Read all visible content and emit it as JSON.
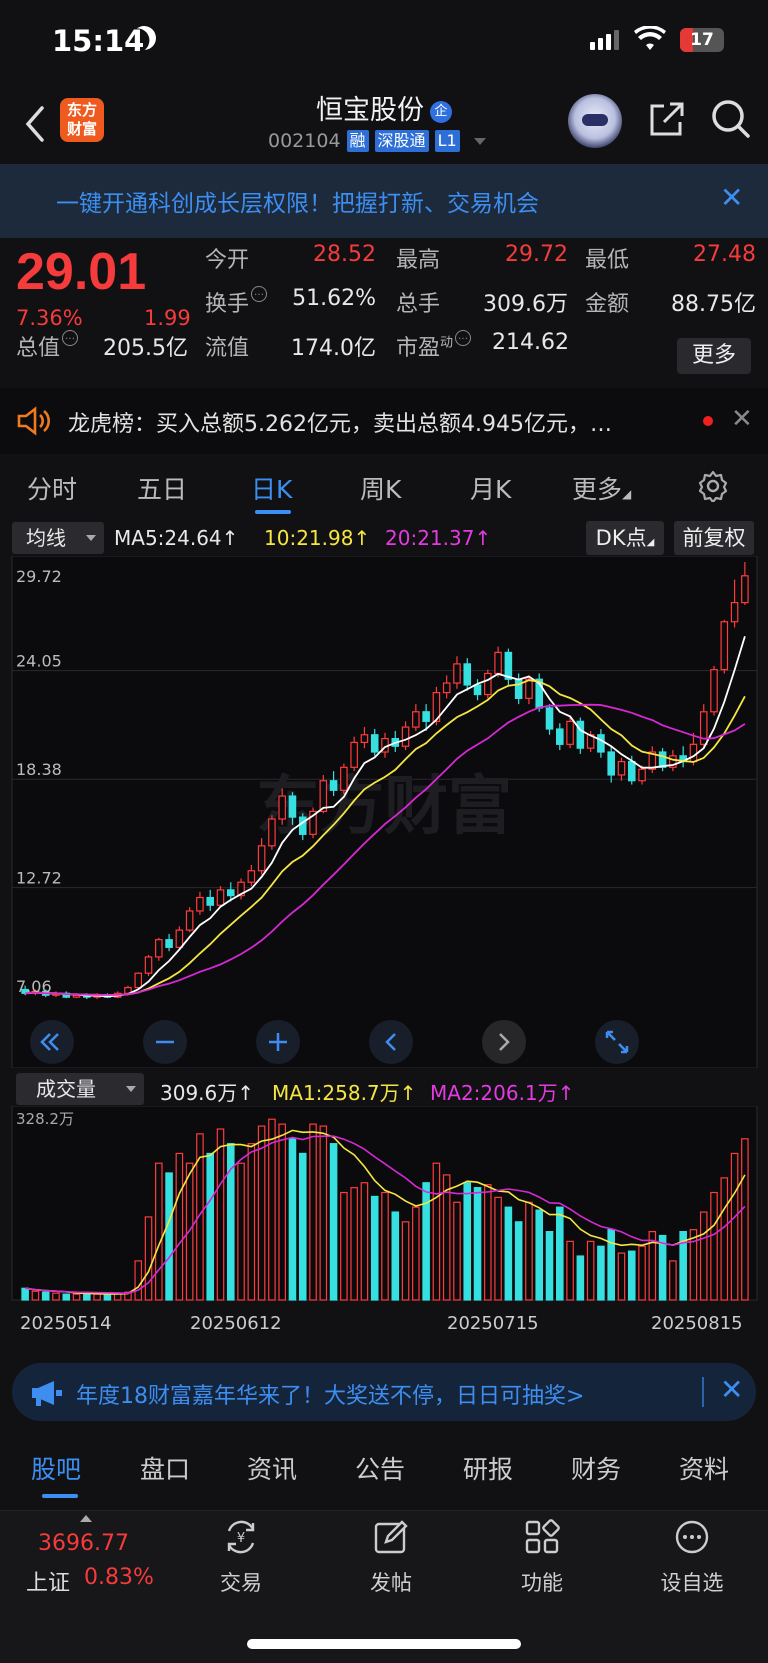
{
  "status_bar": {
    "time": "15:14",
    "battery": "17"
  },
  "header": {
    "logo_line1": "东方",
    "logo_line2": "财富",
    "stock_name": "恒宝股份",
    "name_badge": "企",
    "stock_code": "002104",
    "tags": [
      "融",
      "深股通",
      "L1"
    ]
  },
  "banner": {
    "text": "一键开通科创成长层权限！把握打新、交易机会"
  },
  "quote": {
    "price": "29.01",
    "change_pct": "7.36%",
    "change": "1.99",
    "open_label": "今开",
    "open": "28.52",
    "high_label": "最高",
    "high": "29.72",
    "low_label": "最低",
    "low": "27.48",
    "turnover_label": "换手",
    "turnover": "51.62%",
    "volume_label": "总手",
    "volume": "309.6万",
    "amount_label": "金额",
    "amount": "88.75亿",
    "mktcap_label": "总值",
    "mktcap": "205.5亿",
    "float_label": "流值",
    "float": "174.0亿",
    "pe_label": "市盈",
    "pe_sup": "动",
    "pe": "214.62",
    "more": "更多"
  },
  "dragon_tiger": {
    "text": "龙虎榜：买入总额5.262亿元，卖出总额4.945亿元，…"
  },
  "tabs": {
    "items": [
      "分时",
      "五日",
      "日K",
      "周K",
      "月K",
      "更多"
    ],
    "active": "日K"
  },
  "chart_controls": {
    "ma_select": "均线",
    "ma5": "MA5:24.64",
    "ma10": "10:21.98",
    "ma20": "20:21.37",
    "dk": "DK点",
    "adjust": "前复权",
    "vol_select": "成交量",
    "vol": "309.6万",
    "vol_ma1": "MA1:258.7万",
    "vol_ma2": "MA2:206.1万",
    "watermark": "东方财富"
  },
  "chart_data": {
    "type": "candlestick",
    "y_ticks": [
      "29.72",
      "24.05",
      "18.38",
      "12.72",
      "7.06"
    ],
    "ylim": [
      7.06,
      29.72
    ],
    "vol_max_label": "328.2万",
    "x_labels": [
      "20250514",
      "20250612",
      "20250715",
      "20250815"
    ],
    "candles": [
      [
        7.4,
        7.2,
        7.6,
        7.1
      ],
      [
        7.2,
        7.3,
        7.4,
        7.1
      ],
      [
        7.3,
        7.1,
        7.4,
        7.0
      ],
      [
        7.1,
        7.2,
        7.3,
        7.0
      ],
      [
        7.2,
        7.0,
        7.3,
        6.95
      ],
      [
        7.0,
        7.1,
        7.2,
        6.95
      ],
      [
        7.1,
        7.0,
        7.2,
        6.9
      ],
      [
        7.0,
        7.1,
        7.2,
        6.9
      ],
      [
        7.1,
        7.0,
        7.2,
        6.95
      ],
      [
        7.0,
        7.2,
        7.3,
        6.95
      ],
      [
        7.2,
        7.5,
        7.6,
        7.1
      ],
      [
        7.5,
        8.25,
        8.3,
        7.4
      ],
      [
        8.25,
        9.1,
        9.2,
        8.1
      ],
      [
        9.1,
        10.0,
        10.1,
        8.9
      ],
      [
        10.0,
        9.6,
        10.3,
        9.4
      ],
      [
        9.6,
        10.5,
        10.7,
        9.5
      ],
      [
        10.5,
        11.5,
        11.7,
        10.4
      ],
      [
        11.5,
        12.2,
        12.5,
        11.3
      ],
      [
        12.2,
        11.8,
        12.6,
        11.5
      ],
      [
        11.8,
        12.6,
        12.8,
        11.7
      ],
      [
        12.6,
        12.3,
        13.0,
        12.0
      ],
      [
        12.3,
        13.0,
        13.2,
        12.1
      ],
      [
        13.0,
        13.6,
        13.9,
        12.8
      ],
      [
        13.6,
        14.9,
        15.3,
        13.4
      ],
      [
        14.9,
        16.3,
        16.5,
        14.7
      ],
      [
        16.3,
        17.5,
        17.9,
        16.0
      ],
      [
        17.5,
        16.4,
        17.7,
        16.0
      ],
      [
        16.4,
        15.5,
        16.6,
        15.2
      ],
      [
        15.5,
        16.7,
        16.9,
        15.3
      ],
      [
        16.7,
        18.3,
        18.6,
        16.6
      ],
      [
        18.3,
        17.8,
        18.8,
        17.5
      ],
      [
        17.8,
        19.0,
        19.2,
        17.6
      ],
      [
        19.0,
        20.3,
        20.6,
        18.8
      ],
      [
        20.3,
        20.7,
        21.1,
        20.0
      ],
      [
        20.7,
        19.8,
        21.0,
        19.6
      ],
      [
        19.8,
        20.5,
        20.8,
        19.5
      ],
      [
        20.5,
        20.1,
        20.9,
        19.8
      ],
      [
        20.1,
        21.1,
        21.4,
        19.9
      ],
      [
        21.1,
        21.9,
        22.3,
        20.9
      ],
      [
        21.9,
        21.4,
        22.3,
        20.9
      ],
      [
        21.4,
        22.9,
        23.2,
        21.2
      ],
      [
        22.9,
        23.4,
        23.8,
        22.6
      ],
      [
        23.4,
        24.4,
        24.8,
        23.1
      ],
      [
        24.4,
        23.3,
        24.7,
        23.0
      ],
      [
        23.3,
        22.8,
        23.6,
        22.5
      ],
      [
        22.8,
        23.9,
        24.1,
        22.6
      ],
      [
        23.9,
        25.0,
        25.3,
        23.7
      ],
      [
        25.0,
        23.6,
        25.2,
        23.3
      ],
      [
        23.6,
        22.6,
        23.9,
        22.3
      ],
      [
        22.6,
        23.6,
        23.8,
        22.3
      ],
      [
        23.6,
        22.1,
        23.9,
        21.9
      ],
      [
        22.1,
        21.0,
        22.3,
        20.7
      ],
      [
        21.0,
        20.2,
        21.3,
        19.9
      ],
      [
        20.2,
        21.4,
        21.6,
        20.0
      ],
      [
        21.4,
        20.0,
        21.6,
        19.7
      ],
      [
        20.0,
        20.7,
        20.9,
        19.8
      ],
      [
        20.7,
        19.8,
        21.0,
        19.5
      ],
      [
        19.8,
        18.6,
        20.1,
        18.2
      ],
      [
        18.6,
        19.3,
        19.5,
        18.3
      ],
      [
        19.3,
        18.3,
        19.6,
        18.1
      ],
      [
        18.3,
        18.9,
        19.1,
        18.1
      ],
      [
        18.9,
        19.8,
        20.1,
        18.7
      ],
      [
        19.8,
        19.0,
        20.0,
        18.8
      ],
      [
        19.0,
        19.6,
        19.9,
        18.8
      ],
      [
        19.6,
        19.3,
        20.1,
        19.0
      ],
      [
        19.3,
        20.2,
        20.8,
        19.1
      ],
      [
        20.2,
        21.9,
        22.3,
        20.0
      ],
      [
        21.9,
        24.1,
        24.3,
        21.7
      ],
      [
        24.1,
        26.6,
        26.7,
        23.9
      ],
      [
        26.6,
        27.6,
        28.8,
        26.3
      ],
      [
        27.6,
        29.0,
        29.72,
        27.48
      ]
    ],
    "volumes": [
      12,
      9,
      8,
      7,
      6,
      6,
      7,
      6,
      5,
      7,
      8,
      40,
      85,
      140,
      130,
      150,
      140,
      170,
      150,
      175,
      160,
      140,
      160,
      178,
      185,
      180,
      165,
      150,
      180,
      178,
      160,
      110,
      115,
      120,
      106,
      110,
      90,
      80,
      95,
      120,
      140,
      128,
      100,
      120,
      115,
      118,
      105,
      95,
      80,
      100,
      92,
      70,
      95,
      60,
      45,
      60,
      55,
      72,
      48,
      50,
      55,
      70,
      66,
      40,
      70,
      72,
      90,
      110,
      125,
      150,
      165
    ]
  },
  "ad": {
    "text": "年度18财富嘉年华来了！大奖送不停，日日可抽奖>"
  },
  "bottom_tabs": {
    "items": [
      "股吧",
      "盘口",
      "资讯",
      "公告",
      "研报",
      "财务",
      "资料"
    ],
    "active": "股吧"
  },
  "nav": {
    "index_value": "3696.77",
    "index_name": "上证",
    "index_pct": "0.83%",
    "items": [
      "交易",
      "发帖",
      "功能",
      "设自选"
    ]
  }
}
